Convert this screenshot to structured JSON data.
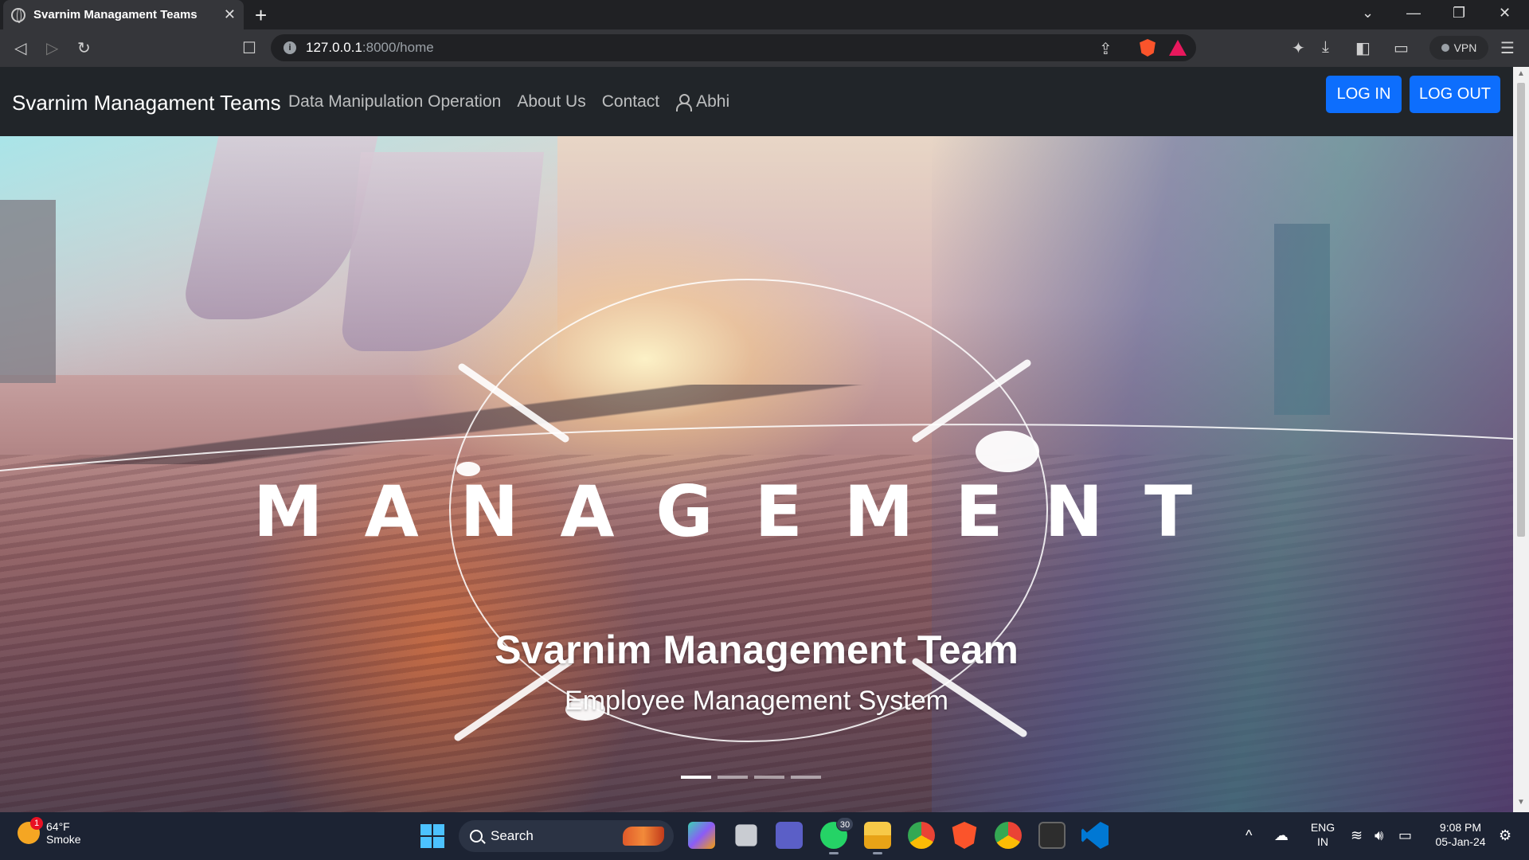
{
  "browser": {
    "tab_title": "Svarnim Managament Teams",
    "tab_close": "✕",
    "new_tab": "+",
    "url_host": "127.0.0.1",
    "url_path": ":8000/home",
    "vpn_label": "VPN"
  },
  "navbar": {
    "brand": "Svarnim Managament Teams",
    "links": [
      "Data Manipulation Operation",
      "About Us",
      "Contact"
    ],
    "user": "Abhi",
    "login": "LOG IN",
    "logout": "LOG OUT"
  },
  "hero": {
    "logo_word": "MANAGEMENT",
    "title": "Svarnim Management Team",
    "subtitle": "Employee Management System",
    "slides": 4,
    "active_slide": 1
  },
  "taskbar": {
    "weather_temp": "64°F",
    "weather_desc": "Smoke",
    "weather_badge": "1",
    "search_label": "Search",
    "whatsapp_badge": "30",
    "lang_top": "ENG",
    "lang_bottom": "IN",
    "time": "9:08 PM",
    "date": "05-Jan-24"
  },
  "colors": {
    "navbar_bg": "#212529",
    "button_primary": "#0d6efd",
    "taskbar_bg": "#1c2333"
  }
}
